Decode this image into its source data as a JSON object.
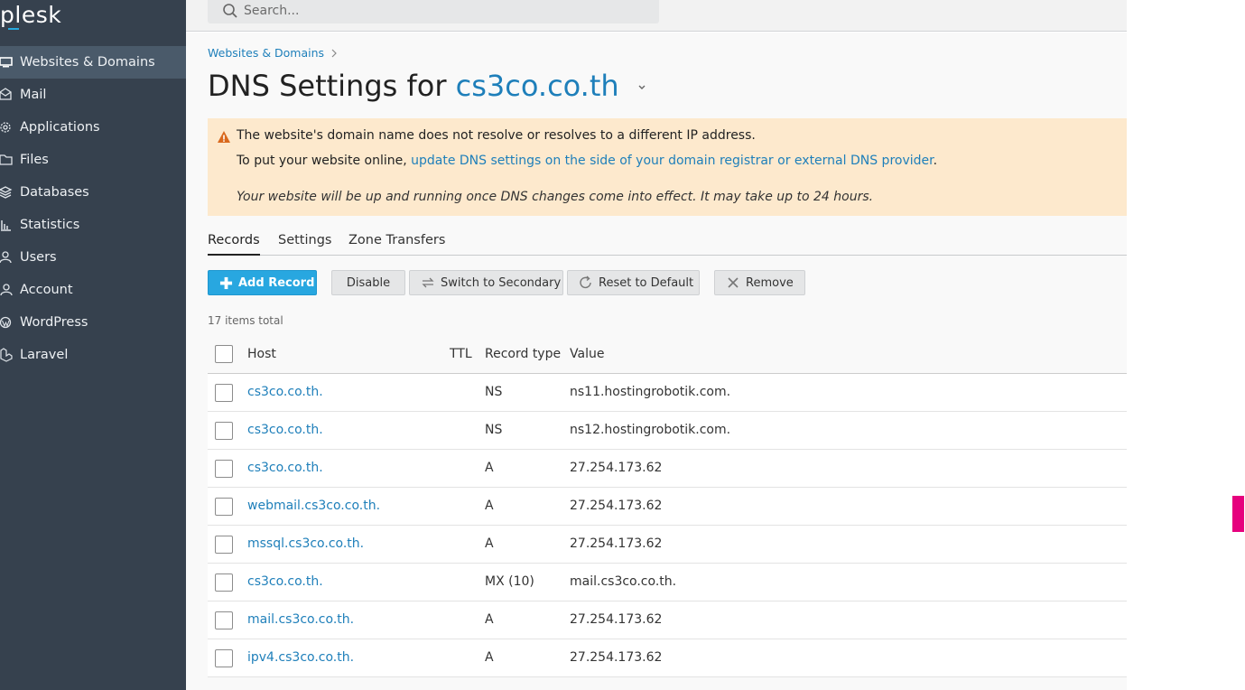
{
  "app": {
    "logo": "plesk"
  },
  "sidebar": {
    "items": [
      {
        "label": "Websites & Domains",
        "icon": "monitor-icon",
        "active": true
      },
      {
        "label": "Mail",
        "icon": "mail-icon"
      },
      {
        "label": "Applications",
        "icon": "gear-icon"
      },
      {
        "label": "Files",
        "icon": "folder-icon"
      },
      {
        "label": "Databases",
        "icon": "database-icon"
      },
      {
        "label": "Statistics",
        "icon": "bar-chart-icon"
      },
      {
        "label": "Users",
        "icon": "user-icon"
      },
      {
        "label": "Account",
        "icon": "account-icon"
      },
      {
        "label": "WordPress",
        "icon": "wordpress-icon"
      },
      {
        "label": "Laravel",
        "icon": "laravel-icon"
      }
    ]
  },
  "search": {
    "placeholder": "Search..."
  },
  "breadcrumb": {
    "label": "Websites & Domains"
  },
  "page": {
    "title_prefix": "DNS Settings for",
    "domain": "cs3co.co.th"
  },
  "warning": {
    "line1": "The website's domain name does not resolve or resolves to a different IP address.",
    "line2_prefix": "To put your website online,",
    "line2_link": "update DNS settings on the side of your domain registrar or external DNS provider",
    "line2_suffix": ".",
    "line3": "Your website will be up and running once DNS changes come into effect. It may take up to 24 hours."
  },
  "tabs": [
    {
      "label": "Records",
      "active": true
    },
    {
      "label": "Settings"
    },
    {
      "label": "Zone Transfers"
    }
  ],
  "toolbar": {
    "add_record": "Add Record",
    "disable": "Disable",
    "switch_secondary": "Switch to Secondary",
    "reset_default": "Reset to Default",
    "remove": "Remove"
  },
  "list": {
    "count": "17 items total",
    "columns": {
      "host": "Host",
      "ttl": "TTL",
      "type": "Record type",
      "value": "Value"
    },
    "rows": [
      {
        "host": "cs3co.co.th.",
        "ttl": "",
        "type": "NS",
        "value": "ns11.hostingrobotik.com."
      },
      {
        "host": "cs3co.co.th.",
        "ttl": "",
        "type": "NS",
        "value": "ns12.hostingrobotik.com."
      },
      {
        "host": "cs3co.co.th.",
        "ttl": "",
        "type": "A",
        "value": "27.254.173.62"
      },
      {
        "host": "webmail.cs3co.co.th.",
        "ttl": "",
        "type": "A",
        "value": "27.254.173.62"
      },
      {
        "host": "mssql.cs3co.co.th.",
        "ttl": "",
        "type": "A",
        "value": "27.254.173.62"
      },
      {
        "host": "cs3co.co.th.",
        "ttl": "",
        "type": "MX (10)",
        "value": "mail.cs3co.co.th."
      },
      {
        "host": "mail.cs3co.co.th.",
        "ttl": "",
        "type": "A",
        "value": "27.254.173.62"
      },
      {
        "host": "ipv4.cs3co.co.th.",
        "ttl": "",
        "type": "A",
        "value": "27.254.173.62"
      }
    ]
  },
  "colors": {
    "sidebar": "#36414e",
    "link": "#1e7fba",
    "primary": "#28a7e0",
    "warning_bg": "#fde9cd",
    "accent_marker": "#e6007e"
  }
}
